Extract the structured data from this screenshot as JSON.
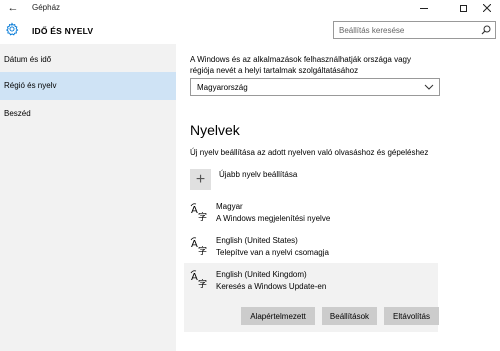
{
  "window": {
    "title": "Gépház"
  },
  "header": {
    "title": "IDŐ ÉS NYELV",
    "search_placeholder": "Beállítás keresése"
  },
  "sidebar": {
    "items": [
      {
        "label": "Dátum és idő",
        "active": false
      },
      {
        "label": "Régió és nyelv",
        "active": true
      },
      {
        "label": "Beszéd",
        "active": false
      }
    ]
  },
  "region": {
    "description": "A Windows és az alkalmazások felhasználhatják országa vagy régiója nevét a helyi tartalmak szolgáltatásához",
    "selected_country": "Magyarország"
  },
  "languages": {
    "title": "Nyelvek",
    "description": "Új nyelv beállítása az adott nyelven való olvasáshoz és gépeléshez",
    "add_label": "Újabb nyelv beállítása",
    "add_glyph": "+",
    "items": [
      {
        "name": "Magyar",
        "status": "A Windows megjelenítési nyelve"
      },
      {
        "name": "English (United States)",
        "status": "Telepítve van a nyelvi csomagja"
      },
      {
        "name": "English (United Kingdom)",
        "status": "Keresés a Windows Update-en"
      }
    ],
    "actions": {
      "default": "Alapértelmezett",
      "settings": "Beállítások",
      "remove": "Eltávolítás"
    }
  },
  "colors": {
    "sidebar_bg": "#f2f2f2",
    "active_item_bg": "#cfe3f5",
    "button_bg": "#cccccc",
    "accent": "#0078d7"
  }
}
